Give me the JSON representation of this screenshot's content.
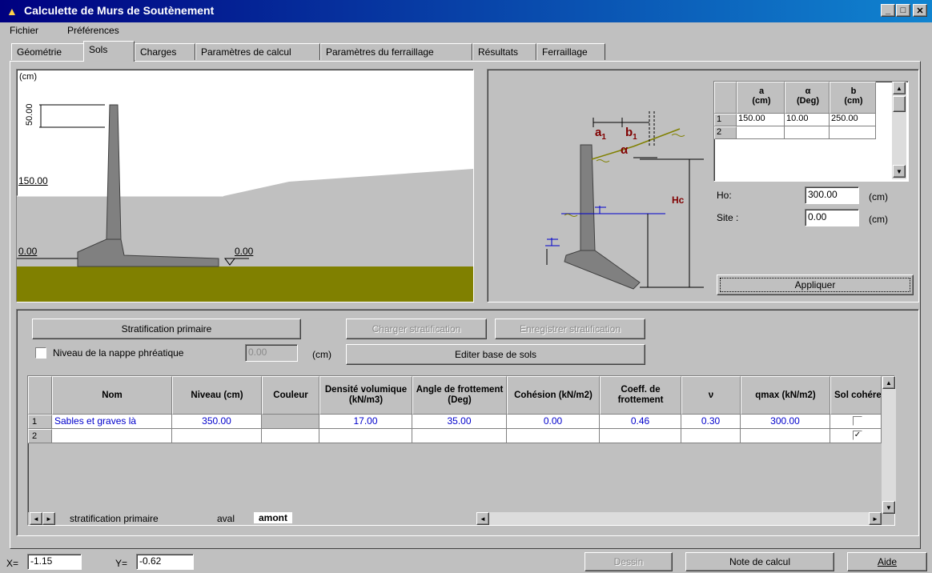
{
  "window": {
    "title": "Calculette de Murs de Soutènement"
  },
  "menu": [
    {
      "label": "Fichier"
    },
    {
      "label": "Préférences"
    }
  ],
  "tabs": [
    {
      "label": "Géométrie"
    },
    {
      "label": "Sols"
    },
    {
      "label": "Charges"
    },
    {
      "label": "Paramètres de calcul"
    },
    {
      "label": "Paramètres du ferraillage"
    },
    {
      "label": "Résultats"
    },
    {
      "label": "Ferraillage"
    }
  ],
  "active_tab": "Sols",
  "drawing": {
    "unit_label": "(cm)",
    "dim_label": "50.00",
    "level_150": "150.00",
    "level_0_left": "0.00",
    "level_0_right": "0.00",
    "colors": {
      "soil": "#c0c0c0",
      "wall": "#808080",
      "ground": "#808000"
    }
  },
  "schema": {
    "labels": {
      "a1": "a",
      "a1_sub": "1",
      "b1": "b",
      "b1_sub": "1",
      "alpha": "α",
      "hc": "Hc"
    }
  },
  "slope_grid": {
    "headers": [
      {
        "top": "a",
        "bottom": "(cm)"
      },
      {
        "top": "α",
        "bottom": "(Deg)"
      },
      {
        "top": "b",
        "bottom": "(cm)"
      }
    ],
    "rows": [
      {
        "n": "1",
        "cells": [
          "150.00",
          "10.00",
          "250.00"
        ]
      },
      {
        "n": "2",
        "cells": [
          "",
          "",
          ""
        ]
      }
    ]
  },
  "ho": {
    "label": "Ho:",
    "value": "300.00",
    "unit": "(cm)"
  },
  "site": {
    "label": "Site :",
    "value": "0.00",
    "unit": "(cm)"
  },
  "apply_button": "Appliquer",
  "buttons": {
    "stratification_primaire": "Stratification primaire",
    "charger": "Charger stratification",
    "enregistrer": "Enregistrer stratification",
    "editer": "Editer base de sols"
  },
  "nappe": {
    "label": "Niveau de la nappe phréatique",
    "value": "0.00",
    "unit": "(cm)",
    "checked": false
  },
  "soil_table": {
    "headers": [
      "Nom",
      "Niveau (cm)",
      "Couleur",
      "Densité volumique (kN/m3)",
      "Angle de frottement (Deg)",
      "Cohésion (kN/m2)",
      "Coeff. de frottement",
      "ν",
      "qmax (kN/m2)",
      "Sol cohére"
    ],
    "rows": [
      {
        "n": "1",
        "nom": "Sables et graves là",
        "niveau": "350.00",
        "couleur": "",
        "densite": "17.00",
        "angle": "35.00",
        "cohesion": "0.00",
        "coeff": "0.46",
        "nu": "0.30",
        "qmax": "300.00",
        "coherent": false
      },
      {
        "n": "2",
        "nom": "",
        "niveau": "",
        "couleur": "",
        "densite": "",
        "angle": "",
        "cohesion": "",
        "coeff": "",
        "nu": "",
        "qmax": "",
        "coherent": true
      }
    ]
  },
  "sheet_tabs": [
    {
      "label": "stratification primaire"
    },
    {
      "label": "aval"
    },
    {
      "label": "amont"
    }
  ],
  "status": {
    "x_label": "X=",
    "x_value": "-1.15",
    "y_label": "Y=",
    "y_value": "-0.62",
    "dessin": "Dessin",
    "note": "Note de calcul",
    "aide": "Aide"
  }
}
